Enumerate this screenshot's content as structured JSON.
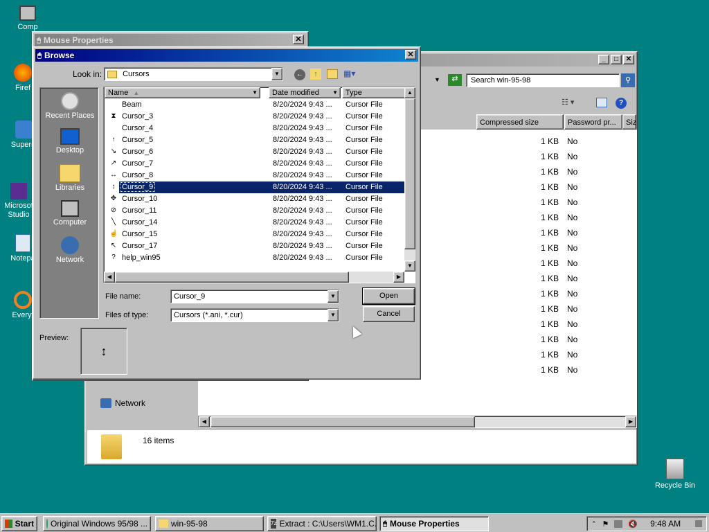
{
  "desktop": {
    "icons": [
      {
        "label": "Comp",
        "icon": "computer-icon"
      },
      {
        "label": "Firef",
        "icon": "firefox-icon"
      },
      {
        "label": "Superm",
        "icon": "shortcut-icon"
      },
      {
        "label": "Microsof Studio",
        "icon": "shortcut-icon"
      },
      {
        "label": "Notepa",
        "icon": "notepad-icon"
      },
      {
        "label": "Everyt",
        "icon": "everything-icon"
      }
    ],
    "recycle_bin": "Recycle Bin"
  },
  "explorer": {
    "search_placeholder": "Search win-95-98",
    "columns": [
      "Compressed size",
      "Password pr...",
      "Size"
    ],
    "rows": [
      {
        "size": "1 KB",
        "pw": "No"
      },
      {
        "size": "1 KB",
        "pw": "No"
      },
      {
        "size": "1 KB",
        "pw": "No"
      },
      {
        "size": "1 KB",
        "pw": "No"
      },
      {
        "size": "1 KB",
        "pw": "No"
      },
      {
        "size": "1 KB",
        "pw": "No"
      },
      {
        "size": "1 KB",
        "pw": "No"
      },
      {
        "size": "1 KB",
        "pw": "No"
      },
      {
        "size": "1 KB",
        "pw": "No"
      },
      {
        "size": "1 KB",
        "pw": "No"
      },
      {
        "size": "1 KB",
        "pw": "No"
      },
      {
        "size": "1 KB",
        "pw": "No"
      },
      {
        "size": "1 KB",
        "pw": "No"
      },
      {
        "size": "1 KB",
        "pw": "No"
      },
      {
        "size": "1 KB",
        "pw": "No"
      },
      {
        "size": "1 KB",
        "pw": "No"
      }
    ],
    "nav_network": "Network",
    "status_items": "16 items"
  },
  "mouse_properties": {
    "title": "Mouse Properties"
  },
  "browse": {
    "title": "Browse",
    "look_in_label": "Look in:",
    "look_in_value": "Cursors",
    "places": [
      "Recent Places",
      "Desktop",
      "Libraries",
      "Computer",
      "Network"
    ],
    "headers": {
      "name": "Name",
      "date": "Date modified",
      "type": "Type"
    },
    "files": [
      {
        "name": "Beam",
        "date": "8/20/2024 9:43 ...",
        "type": "Cursor File",
        "icon": " "
      },
      {
        "name": "Cursor_3",
        "date": "8/20/2024 9:43 ...",
        "type": "Cursor File",
        "icon": "⧗"
      },
      {
        "name": "Cursor_4",
        "date": "8/20/2024 9:43 ...",
        "type": "Cursor File",
        "icon": " "
      },
      {
        "name": "Cursor_5",
        "date": "8/20/2024 9:43 ...",
        "type": "Cursor File",
        "icon": "↑"
      },
      {
        "name": "Cursor_6",
        "date": "8/20/2024 9:43 ...",
        "type": "Cursor File",
        "icon": "↘"
      },
      {
        "name": "Cursor_7",
        "date": "8/20/2024 9:43 ...",
        "type": "Cursor File",
        "icon": "↗"
      },
      {
        "name": "Cursor_8",
        "date": "8/20/2024 9:43 ...",
        "type": "Cursor File",
        "icon": "↔"
      },
      {
        "name": "Cursor_9",
        "date": "8/20/2024 9:43 ...",
        "type": "Cursor File",
        "icon": "↕",
        "selected": true
      },
      {
        "name": "Cursor_10",
        "date": "8/20/2024 9:43 ...",
        "type": "Cursor File",
        "icon": "✥"
      },
      {
        "name": "Cursor_11",
        "date": "8/20/2024 9:43 ...",
        "type": "Cursor File",
        "icon": "⊘"
      },
      {
        "name": "Cursor_14",
        "date": "8/20/2024 9:43 ...",
        "type": "Cursor File",
        "icon": "╲"
      },
      {
        "name": "Cursor_15",
        "date": "8/20/2024 9:43 ...",
        "type": "Cursor File",
        "icon": "☝"
      },
      {
        "name": "Cursor_17",
        "date": "8/20/2024 9:43 ...",
        "type": "Cursor File",
        "icon": "↖"
      },
      {
        "name": "help_win95",
        "date": "8/20/2024 9:43 ...",
        "type": "Cursor File",
        "icon": "?"
      }
    ],
    "file_name_label": "File name:",
    "file_name_value": "Cursor_9",
    "file_type_label": "Files of type:",
    "file_type_value": "Cursors (*.ani, *.cur)",
    "open_label": "Open",
    "cancel_label": "Cancel",
    "preview_label": "Preview:",
    "preview_glyph": "↕"
  },
  "taskbar": {
    "start": "Start",
    "tasks": [
      "Original Windows 95/98 ...",
      "win-95-98",
      "Extract : C:\\Users\\WM1.C...",
      "Mouse Properties"
    ],
    "clock": "9:48 AM"
  }
}
